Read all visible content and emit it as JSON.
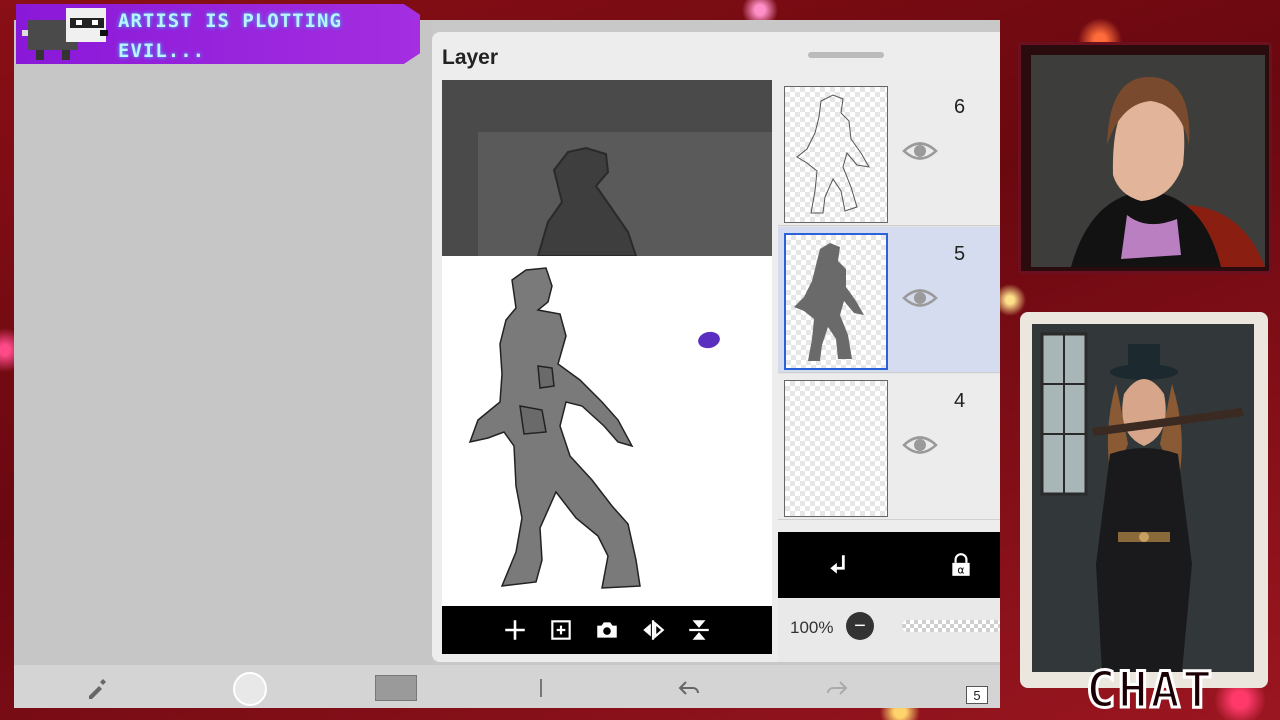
{
  "overlay": {
    "banner_text": "ARTIST IS PLOTTING EVIL...",
    "chat_label": "CHAT"
  },
  "layer_panel": {
    "title": "Layer",
    "layers": [
      {
        "number": "6",
        "visible": true,
        "selected": false
      },
      {
        "number": "5",
        "visible": true,
        "selected": true
      },
      {
        "number": "4",
        "visible": true,
        "selected": false
      }
    ],
    "opacity": "100%",
    "preview_actions": [
      "add-layer-icon",
      "add-layer-copy-icon",
      "camera-icon",
      "flip-horizontal-icon",
      "flip-vertical-icon"
    ],
    "blend_icons": [
      "clipping-arrow-icon",
      "alpha-lock-icon"
    ]
  },
  "toolbar": {
    "page_number": "5"
  },
  "colors": {
    "accent_selected": "#2c62d8",
    "banner": "#a42ee0",
    "paint_blob": "#5a2fc0"
  }
}
